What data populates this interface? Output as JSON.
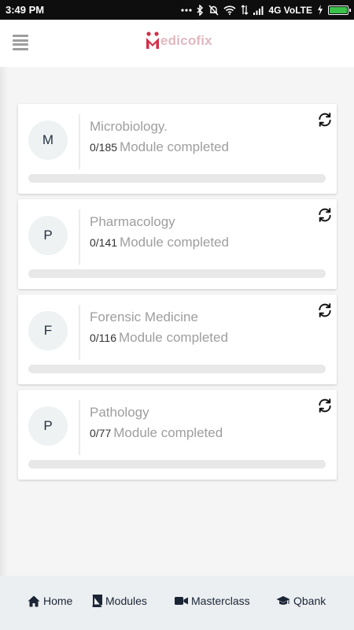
{
  "status_bar": {
    "time": "3:49 PM",
    "network": "4G VoLTE",
    "battery_level": 1.0
  },
  "app_bar": {
    "menu_icon": "menu-icon",
    "logo_text": "edicofix"
  },
  "subjects": [
    {
      "initial": "M",
      "title": "Microbiology.",
      "completed": "0/185",
      "label": "Module completed",
      "progress": 0
    },
    {
      "initial": "P",
      "title": "Pharmacology",
      "completed": "0/141",
      "label": "Module completed",
      "progress": 0
    },
    {
      "initial": "F",
      "title": "Forensic Medicine",
      "completed": "0/116",
      "label": "Module completed",
      "progress": 0
    },
    {
      "initial": "P",
      "title": "Pathology",
      "completed": "0/77",
      "label": "Module completed",
      "progress": 0
    }
  ],
  "bottom_nav": {
    "home": "Home",
    "modules": "Modules",
    "masterclass": "Masterclass",
    "qbank": "Qbank"
  },
  "colors": {
    "accent": "#2d6cdf",
    "logo_red": "#d32f4a",
    "nav_text": "#1b2536"
  }
}
